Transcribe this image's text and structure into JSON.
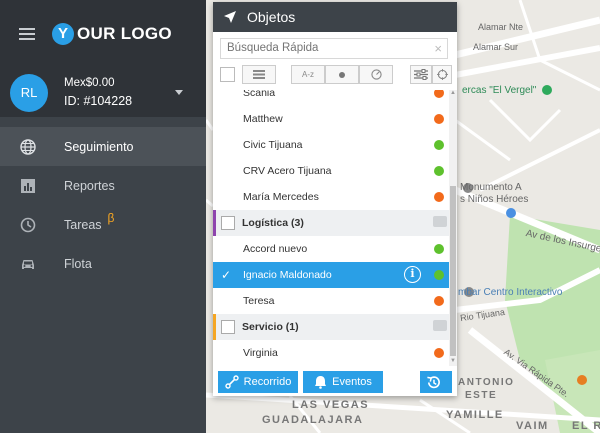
{
  "logo": {
    "letter": "Y",
    "text": "OUR LOGO"
  },
  "account": {
    "initials": "RL",
    "balance": "Mex$0.00",
    "id": "ID: #104228"
  },
  "nav": [
    {
      "label": "Seguimiento",
      "icon": "globe-icon",
      "active": true
    },
    {
      "label": "Reportes",
      "icon": "chart-icon",
      "active": false
    },
    {
      "label": "Tareas",
      "icon": "clock-icon",
      "active": false,
      "badge": "β"
    },
    {
      "label": "Flota",
      "icon": "car-icon",
      "active": false
    }
  ],
  "panel": {
    "title": "Objetos",
    "search_placeholder": "Búsqueda Rápida",
    "sort_label": "A-z",
    "rows": [
      {
        "type": "item",
        "name": "Scania",
        "status": "orange"
      },
      {
        "type": "item",
        "name": "Matthew",
        "status": "orange"
      },
      {
        "type": "item",
        "name": "Civic Tijuana",
        "status": "green"
      },
      {
        "type": "item",
        "name": "CRV Acero Tijuana",
        "status": "green"
      },
      {
        "type": "item",
        "name": "María Mercedes",
        "status": "orange"
      },
      {
        "type": "group",
        "name": "Logística (3)",
        "color": "#8e44ad"
      },
      {
        "type": "item",
        "name": "Accord nuevo",
        "status": "green"
      },
      {
        "type": "selected",
        "name": "Ignacio Maldonado",
        "status": "green"
      },
      {
        "type": "item",
        "name": "Teresa",
        "status": "orange"
      },
      {
        "type": "group",
        "name": "Servicio (1)",
        "color": "#f5a623"
      },
      {
        "type": "item",
        "name": "Virginia",
        "status": "orange"
      }
    ],
    "footer": {
      "route_label": "Recorrido",
      "events_label": "Eventos"
    }
  },
  "map_labels": {
    "alamar_nte": "Alamar Nte",
    "alamar_sur": "Alamar Sur",
    "vergel": "ercas \"El Vergel\"",
    "monumento1": "Monumento A",
    "monumento2": "s Niños Héroes",
    "insurgentes": "Av de los Insurge",
    "centro": "mbar Centro Interactivo",
    "rio_tijuana": "Rio Tijuana",
    "via_rapida": "Av. Via Rápida Pte.",
    "antonio": "ANTONIO",
    "este": "ESTE",
    "las_vegas": "LAS VEGAS",
    "guadalajara": "GUADALAJARA",
    "yamille": "YAMILLE",
    "vaim": "VAIM",
    "el_r": "EL R"
  },
  "colors": {
    "accent": "#2a9fe6",
    "sidebar": "#3d4349",
    "online": "#5ec12d",
    "offline": "#f26a1b"
  }
}
